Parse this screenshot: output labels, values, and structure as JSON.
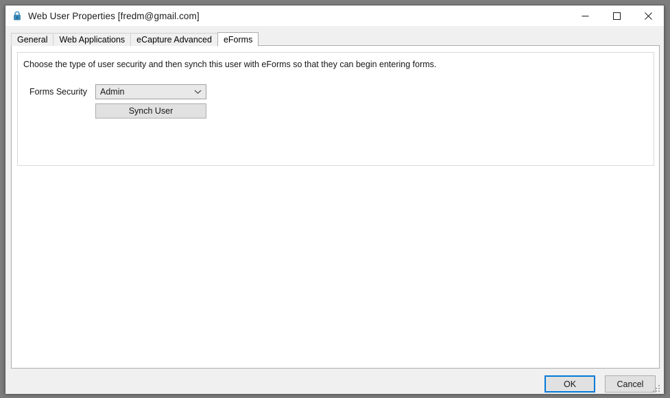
{
  "window": {
    "title": "Web User Properties [fredm@gmail.com]",
    "icon": "lock-icon",
    "controls": {
      "minimize": "minimize-icon",
      "maximize": "maximize-icon",
      "close": "close-icon"
    }
  },
  "tabs": [
    {
      "label": "General",
      "active": false
    },
    {
      "label": "Web Applications",
      "active": false
    },
    {
      "label": "eCapture Advanced",
      "active": false
    },
    {
      "label": "eForms",
      "active": true
    }
  ],
  "panel": {
    "description": "Choose the type of user security and then synch this user with eForms so that they can begin entering forms.",
    "forms_security": {
      "label": "Forms Security",
      "value": "Admin",
      "options": [
        "Admin"
      ],
      "arrow_icon": "chevron-down-icon"
    },
    "synch_button": "Synch User"
  },
  "footer": {
    "ok": "OK",
    "cancel": "Cancel"
  },
  "colors": {
    "accent": "#0078d7",
    "dialog_background": "#f0f0f0",
    "page_background": "#ffffff",
    "lock_icon": "#3a8dbd"
  }
}
